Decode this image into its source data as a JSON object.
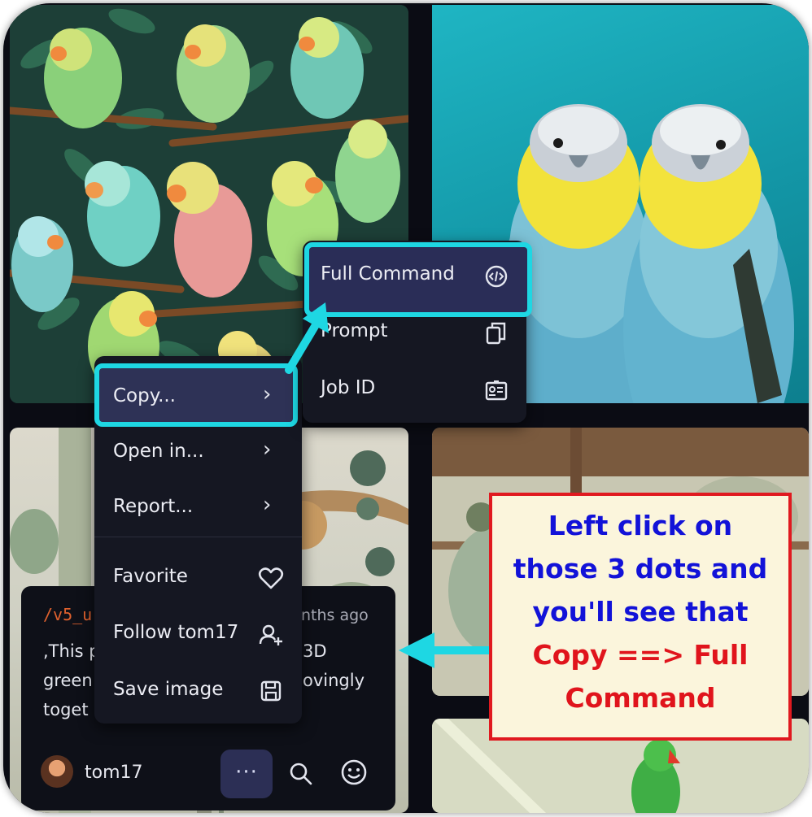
{
  "menu": {
    "items": [
      {
        "label": "Copy...",
        "icon": "chevron-right-icon"
      },
      {
        "label": "Open in...",
        "icon": "chevron-right-icon"
      },
      {
        "label": "Report...",
        "icon": "chevron-right-icon"
      },
      {
        "label": "Favorite",
        "icon": "heart-icon"
      },
      {
        "label": "Follow tom17",
        "icon": "user-plus-icon"
      },
      {
        "label": "Save image",
        "icon": "save-icon"
      }
    ]
  },
  "submenu": {
    "items": [
      {
        "label": "Full Command",
        "icon": "code-icon"
      },
      {
        "label": "Prompt",
        "icon": "copy-icon"
      },
      {
        "label": "Job ID",
        "icon": "id-card-icon"
      }
    ]
  },
  "card": {
    "username_tag": "/v5_u",
    "time": "nths ago",
    "desc_left": [
      ",This p",
      "green",
      "toget"
    ],
    "desc_right": [
      "3D",
      "ovingly"
    ],
    "username": "tom17",
    "more_button": "···"
  },
  "callout": {
    "lines_blue": [
      "Left click on",
      "those 3 dots and",
      "you'll see that"
    ],
    "lines_red": [
      "Copy ==> Full",
      "Command"
    ]
  },
  "colors": {
    "highlight": "#1ed7e3",
    "menu_bg": "#151722",
    "callout_border": "#e0191f",
    "callout_blue": "#1212d8",
    "callout_red": "#e0141c"
  }
}
